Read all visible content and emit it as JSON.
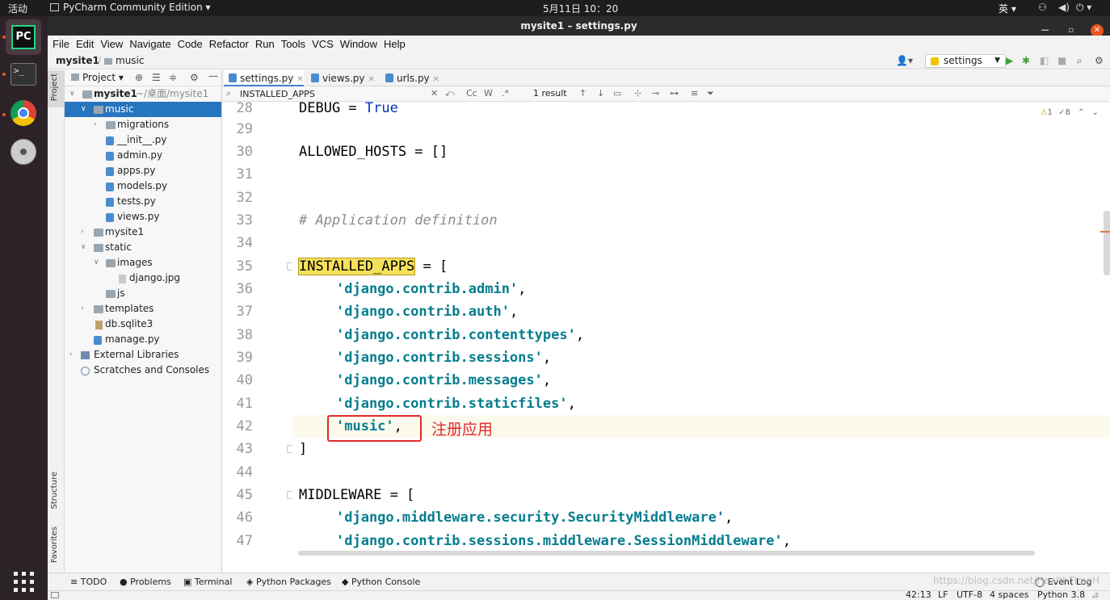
{
  "topbar": {
    "activities": "活动",
    "app_menu": "PyCharm Community Edition",
    "clock": "5月11日 10：20",
    "ime": "英"
  },
  "window": {
    "title": "mysite1 – settings.py"
  },
  "menu": [
    "File",
    "Edit",
    "View",
    "Navigate",
    "Code",
    "Refactor",
    "Run",
    "Tools",
    "VCS",
    "Window",
    "Help"
  ],
  "breadcrumb": {
    "project": "mysite1",
    "sep": "/",
    "folder": "music"
  },
  "run_config": "settings",
  "left_tabs": {
    "project": "Project",
    "structure": "Structure",
    "favorites": "Favorites"
  },
  "project_panel": {
    "title": "Project",
    "tree": [
      {
        "label": "mysite1",
        "sub": "~/桌面/mysite1"
      },
      {
        "label": "music"
      },
      {
        "label": "migrations"
      },
      {
        "label": "__init__.py"
      },
      {
        "label": "admin.py"
      },
      {
        "label": "apps.py"
      },
      {
        "label": "models.py"
      },
      {
        "label": "tests.py"
      },
      {
        "label": "views.py"
      },
      {
        "label": "mysite1"
      },
      {
        "label": "static"
      },
      {
        "label": "images"
      },
      {
        "label": "django.jpg"
      },
      {
        "label": "js"
      },
      {
        "label": "templates"
      },
      {
        "label": "db.sqlite3"
      },
      {
        "label": "manage.py"
      },
      {
        "label": "External Libraries"
      },
      {
        "label": "Scratches and Consoles"
      }
    ]
  },
  "tabs": [
    {
      "label": "settings.py"
    },
    {
      "label": "views.py"
    },
    {
      "label": "urls.py"
    }
  ],
  "search": {
    "query": "INSTALLED_APPS",
    "result": "1 result",
    "case": "Cc",
    "words": "W",
    "regex": ".*"
  },
  "inspections": {
    "warnings": "1",
    "typos": "8"
  },
  "editor": {
    "line_numbers": [
      "28",
      "29",
      "30",
      "31",
      "32",
      "33",
      "34",
      "35",
      "36",
      "37",
      "38",
      "39",
      "40",
      "41",
      "42",
      "43",
      "44",
      "45",
      "46",
      "47"
    ],
    "lines": {
      "l28a": "DEBUG = ",
      "l28b": "True",
      "l30": "ALLOWED_HOSTS = []",
      "l33": "# Application definition",
      "l35a": "INSTALLED_APPS",
      "l35b": " = [",
      "l36": "'django.contrib.admin'",
      "l37": "'django.contrib.auth'",
      "l38": "'django.contrib.contenttypes'",
      "l39": "'django.contrib.sessions'",
      "l40": "'django.contrib.messages'",
      "l41": "'django.contrib.staticfiles'",
      "l42": "'music'",
      "l43": "]",
      "l45": "MIDDLEWARE = [",
      "l46": "'django.middleware.security.SecurityMiddleware'",
      "l47": "'django.contrib.sessions.middleware.SessionMiddleware'",
      "comma": ","
    },
    "annotation": "注册应用"
  },
  "bottom_tools": [
    "TODO",
    "Problems",
    "Terminal",
    "Python Packages",
    "Python Console"
  ],
  "event_log": "Event Log",
  "status": {
    "position": "42:13",
    "line_sep": "LF",
    "encoding": "UTF-8",
    "indent": "4 spaces",
    "interpreter": "Python 3.8"
  },
  "watermark": "https://blog.csdn.net/HealthTimeH"
}
